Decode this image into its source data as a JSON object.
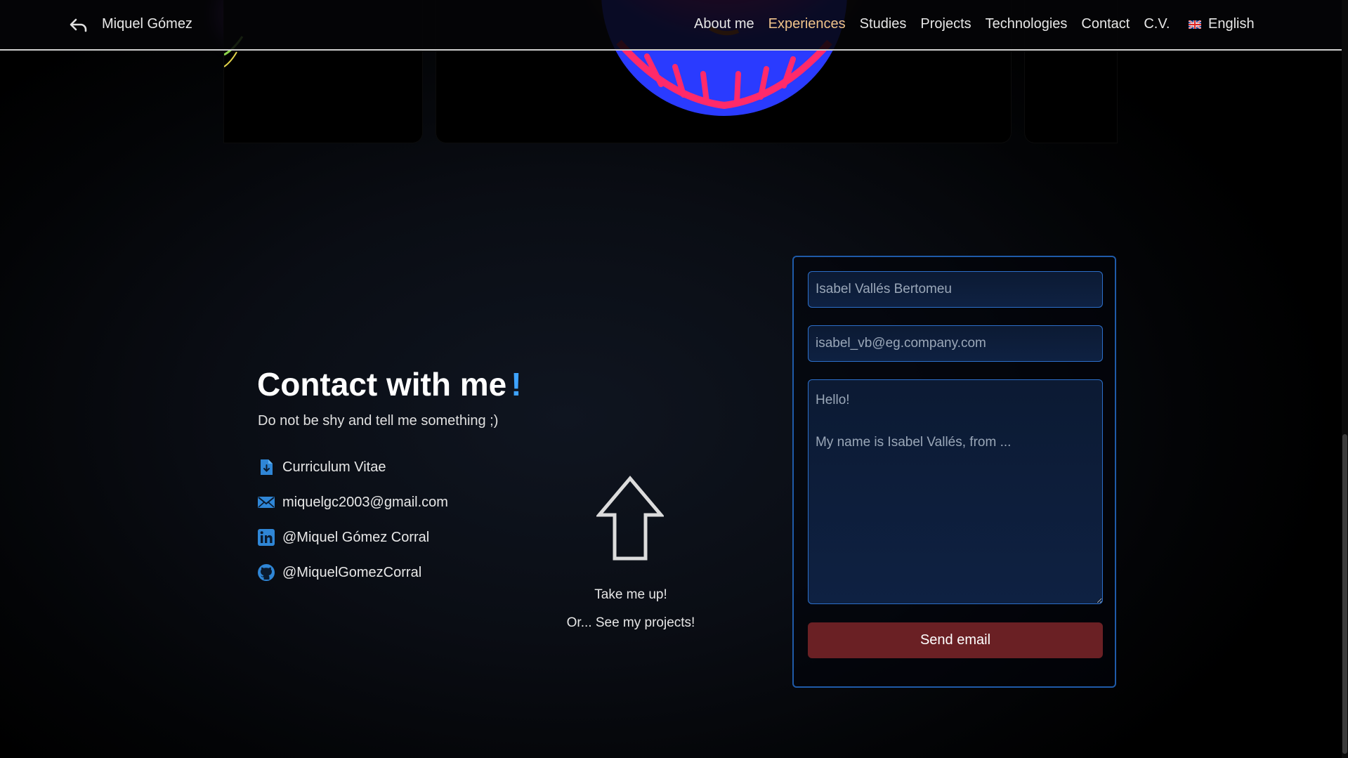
{
  "header": {
    "brand": "Miquel Gómez",
    "nav": [
      {
        "label": "About me"
      },
      {
        "label": "Experiences"
      },
      {
        "label": "Studies"
      },
      {
        "label": "Projects"
      },
      {
        "label": "Technologies"
      },
      {
        "label": "Contact"
      },
      {
        "label": "C.V."
      }
    ],
    "language": "English",
    "back_icon": "back-arrow-icon",
    "flag_icon": "uk-flag-icon"
  },
  "contact": {
    "title": "Contact with me",
    "title_accent": "!",
    "subtitle": "Do not be shy and tell me something ;)",
    "links": [
      {
        "icon": "document-download-icon",
        "label": "Curriculum Vitae"
      },
      {
        "icon": "mail-icon",
        "label": "miquelgc2003@gmail.com"
      },
      {
        "icon": "linkedin-icon",
        "label": "@Miquel Gómez Corral"
      },
      {
        "icon": "github-icon",
        "label": "@MiquelGomezCorral"
      }
    ],
    "take_me_up": "Take me up!",
    "see_projects": "Or... See my projects!"
  },
  "form": {
    "name_placeholder": "Isabel Vallés Bertomeu",
    "email_placeholder": "isabel_vb@eg.company.com",
    "message_placeholder": "Hello!\n\nMy name is Isabel Vallés, from ...",
    "send_label": "Send email"
  },
  "colors": {
    "accent_blue": "#3ea3ff",
    "active_nav": "#f0c38a",
    "form_border": "#1f5aa8",
    "send_button": "#6a2024"
  }
}
